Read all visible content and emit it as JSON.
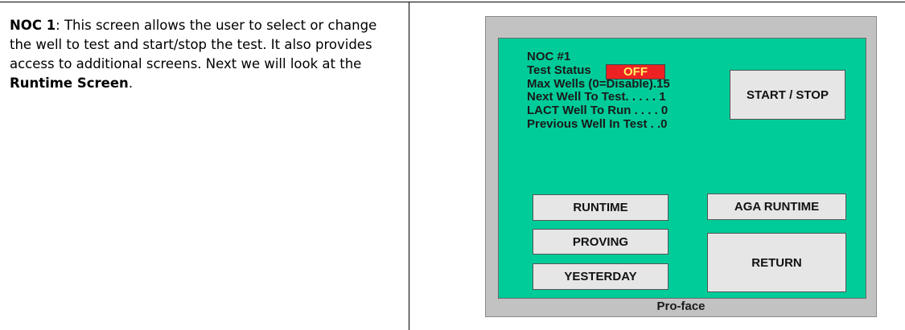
{
  "description": {
    "heading": "NOC 1",
    "text": ":  This screen allows the user to select or change the well to test and start/stop the test.  It also provides access to additional screens.  Next we will look at the ",
    "link_text": "Runtime Screen",
    "end": "."
  },
  "hmi": {
    "title": "NOC #1",
    "test_status_label": "Test Status",
    "test_status_value": "OFF",
    "max_wells": "Max Wells (0=Disable).15",
    "next_well": "Next Well To Test. . . . . 1",
    "lact_well": "LACT Well To Run . . . . 0",
    "previous_well": "Previous Well In Test . .0",
    "buttons": {
      "start_stop": "START / STOP",
      "runtime": "RUNTIME",
      "aga_runtime": "AGA  RUNTIME",
      "proving": "PROVING",
      "return": "RETURN",
      "yesterday": "YESTERDAY"
    },
    "brand": "Pro-face",
    "colors": {
      "screen": "#00cc99",
      "status_off": "#ee2222",
      "status_text": "#ffee66",
      "bezel": "#c2c2c2",
      "button": "#e6e6e6"
    }
  }
}
